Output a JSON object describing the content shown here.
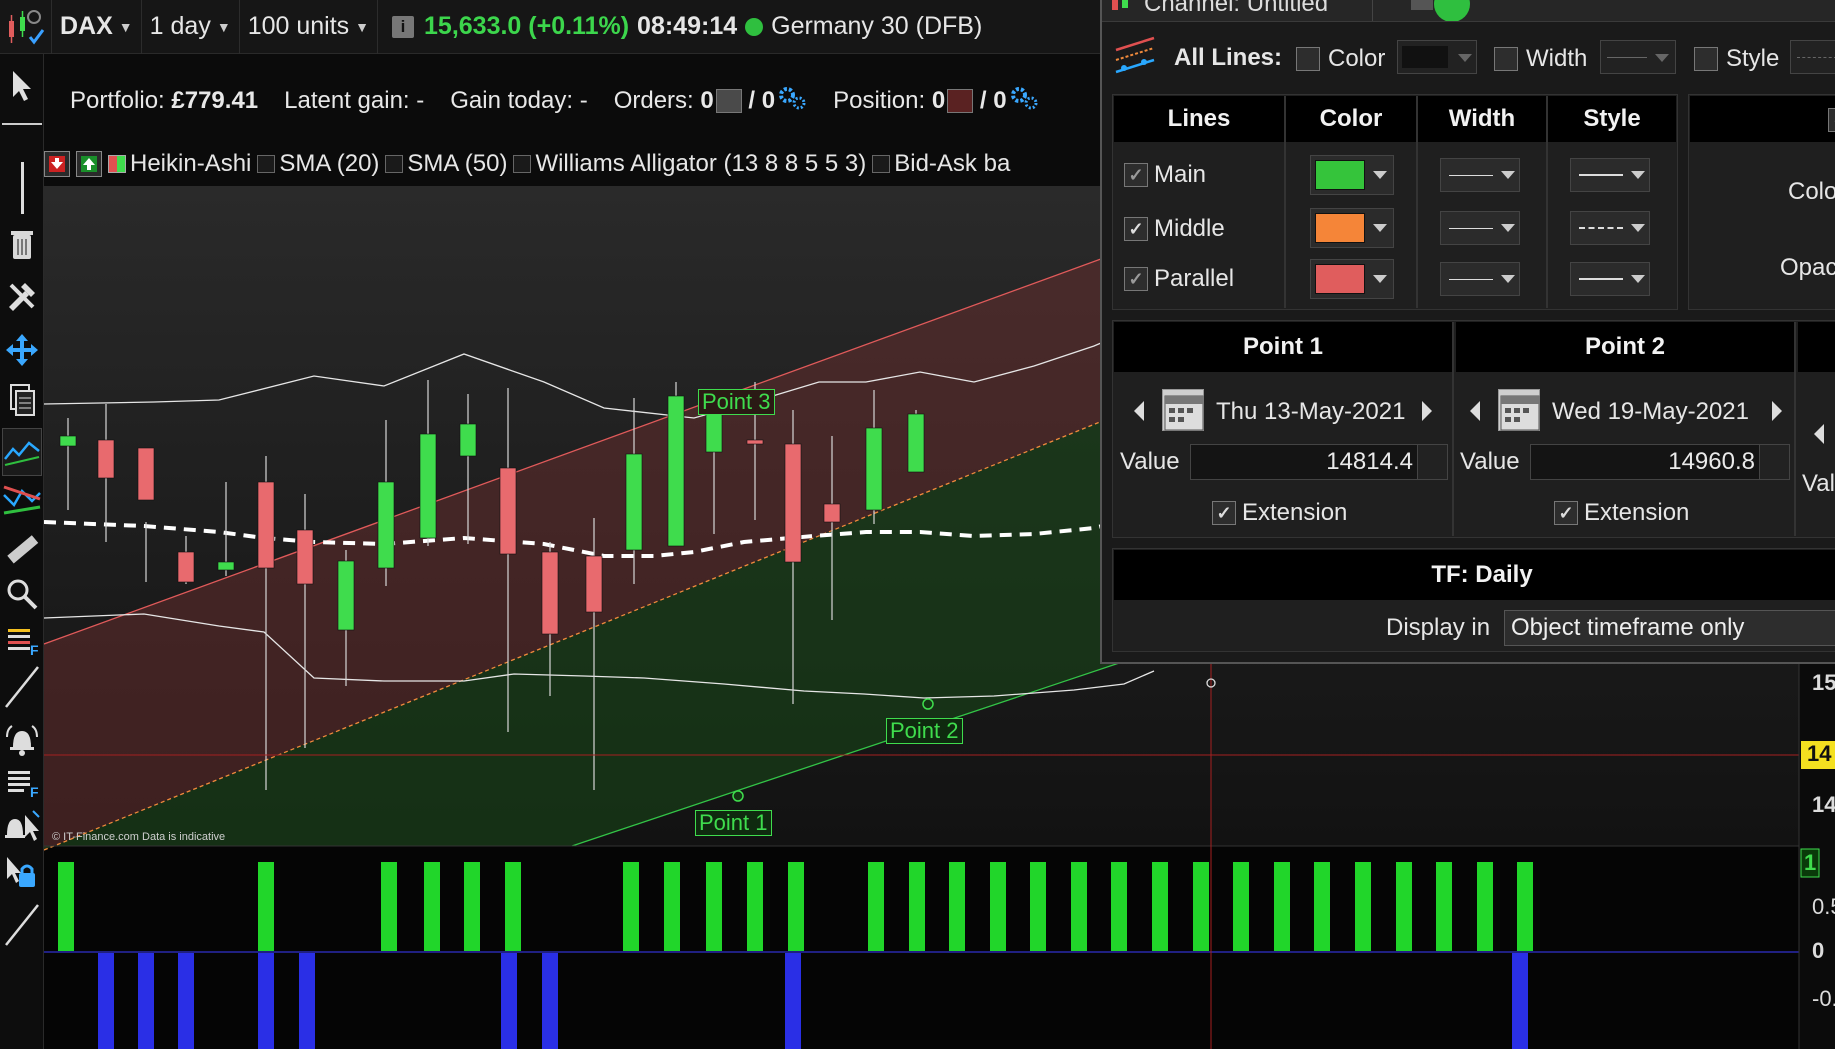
{
  "topbar": {
    "instrument_select": "DAX",
    "timeframe_select": "1 day",
    "units_select": "100 units",
    "price": "15,633.0 (+0.11%)",
    "time": "08:49:14",
    "market_name": "Germany 30 (DFB)"
  },
  "portfolio": {
    "portfolio_label": "Portfolio:",
    "portfolio_value": "£779.41",
    "latent_label": "Latent gain:",
    "latent_value": "-",
    "gain_today_label": "Gain today:",
    "gain_today_value": "-",
    "orders_label": "Orders:",
    "orders_value_a": "0",
    "orders_value_b": "/ 0",
    "position_label": "Position:",
    "position_value_a": "0",
    "position_value_b": "/ 0"
  },
  "indicators": {
    "items": [
      {
        "label": "Heikin-Ashi"
      },
      {
        "label": "SMA (20)"
      },
      {
        "label": "SMA (50)"
      },
      {
        "label": "Williams Alligator (13 8 8 5 5 3)"
      },
      {
        "label": "Bid-Ask ba"
      }
    ]
  },
  "chart": {
    "copyright": "© IT-Finance.com  Data is indicative",
    "point_labels": [
      "Point 1",
      "Point 2",
      "Point 3"
    ],
    "axis_labels": [
      "15",
      "14",
      "14",
      "1",
      "0.5",
      "0",
      "-0."
    ],
    "colors": {
      "bull": "#3fdc4d",
      "bear": "#e86a6e",
      "channel_top": "#e05a5a",
      "channel_mid": "#f08a3c",
      "channel_bottom": "#33c447",
      "histo_up": "#21d62a",
      "histo_down": "#2a2fe6"
    }
  },
  "dialog": {
    "title": "Channel: Untitled",
    "all_lines_label": "All Lines:",
    "color_label": "Color",
    "width_label": "Width",
    "style_label": "Style",
    "table_headers": [
      "Lines",
      "Color",
      "Width",
      "Style"
    ],
    "rows": [
      {
        "name": "Main",
        "color": "#35c43b"
      },
      {
        "name": "Middle",
        "color": "#f58538"
      },
      {
        "name": "Parallel",
        "color": "#e05d5d"
      }
    ],
    "side_color_label": "Color",
    "side_opacity_label": "Opacity",
    "point1": {
      "header": "Point 1",
      "date": "Thu 13-May-2021",
      "value_label": "Value",
      "value": "14814.4",
      "extension_label": "Extension"
    },
    "point2": {
      "header": "Point 2",
      "date": "Wed 19-May-2021",
      "value_label": "Value",
      "value": "14960.8",
      "extension_label": "Extension"
    },
    "point3_value_label": "Val",
    "tf_label": "TF: Daily",
    "display_in_label": "Display in",
    "display_in_value": "Object timeframe only"
  }
}
